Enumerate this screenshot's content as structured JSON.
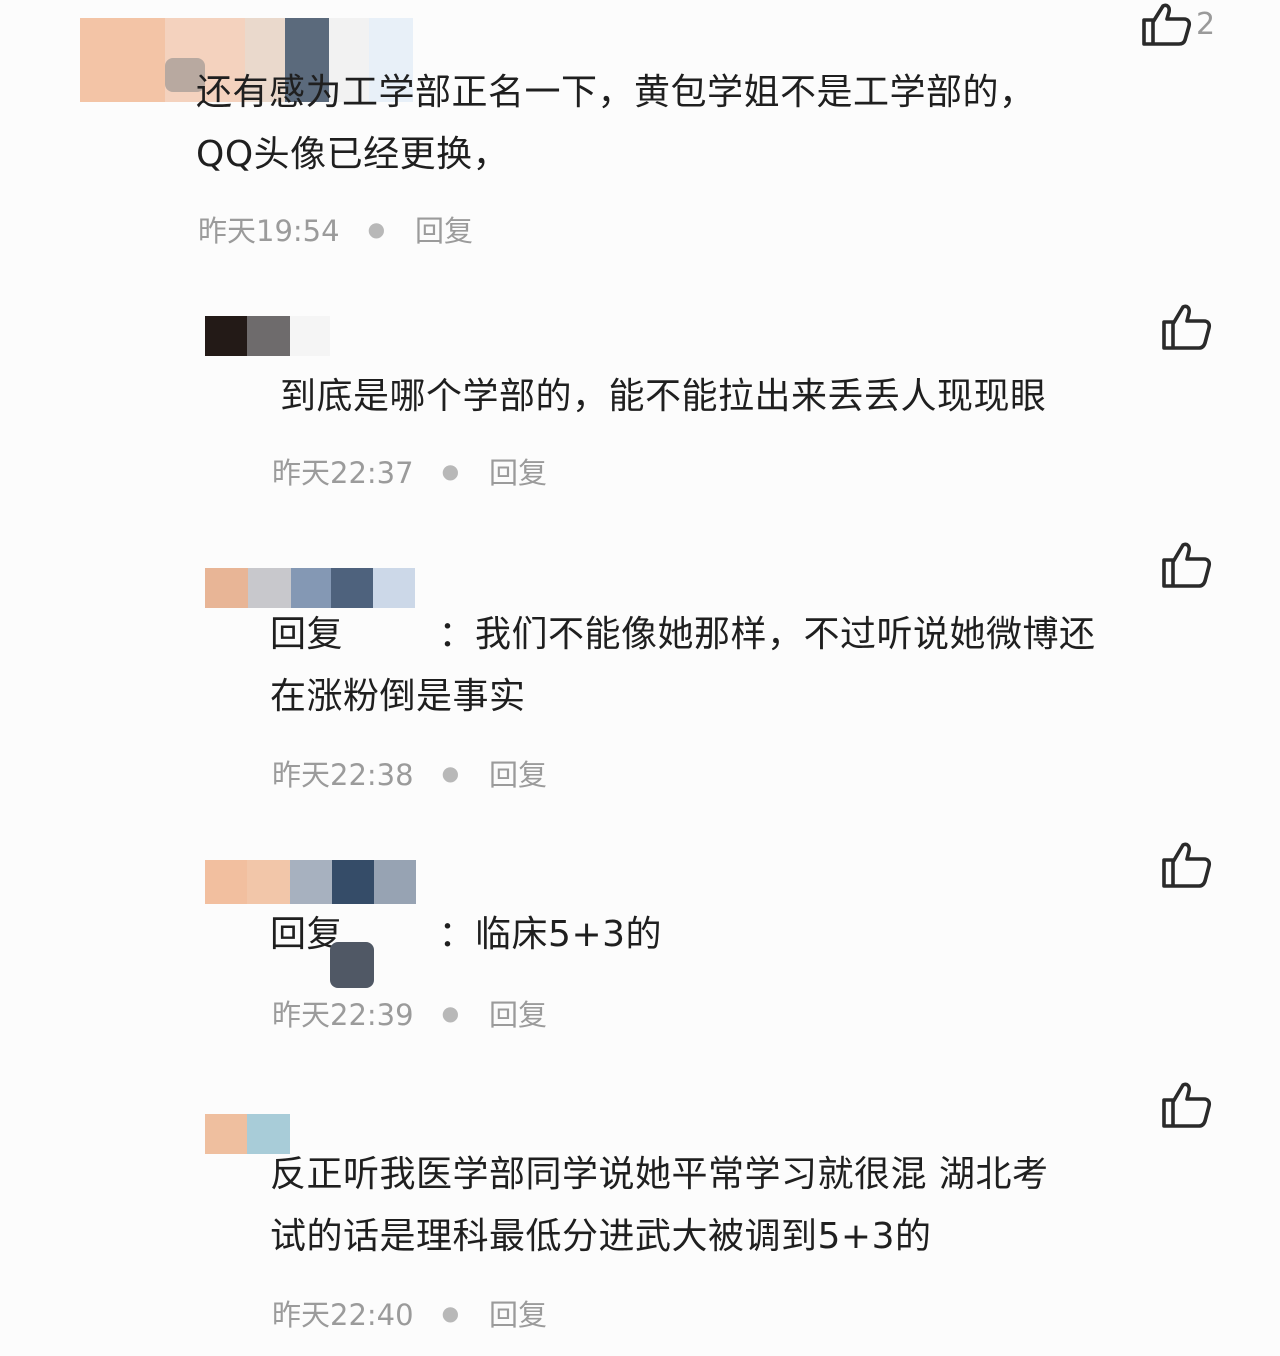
{
  "comments": [
    {
      "text": "还有感为工学部正名一下，黄包学姐不是工学部的，\nQQ头像已经更换，",
      "time": "昨天19:54",
      "reply_label": "回复",
      "like_count": "2"
    },
    {
      "text": "到底是哪个学部的，能不能拉出来丢丢人现现眼",
      "time": "昨天22:37",
      "reply_label": "回复",
      "like_count": ""
    },
    {
      "text": "回复        ：我们不能像她那样，不过听说她微博还\n在涨粉倒是事实",
      "time": "昨天22:38",
      "reply_label": "回复",
      "like_count": ""
    },
    {
      "text": "回复        ：临床5+3的",
      "time": "昨天22:39",
      "reply_label": "回复",
      "like_count": ""
    },
    {
      "text": "反正听我医学部同学说她平常学习就很混 湖北考\n试的话是理科最低分进武大被调到5+3的",
      "time": "昨天22:40",
      "reply_label": "回复",
      "like_count": ""
    }
  ],
  "icons": {
    "like": "thumbs-up-icon"
  },
  "colors": {
    "text": "#1f1f1f",
    "meta": "#9b9b9b",
    "background": "#fcfcfc"
  }
}
